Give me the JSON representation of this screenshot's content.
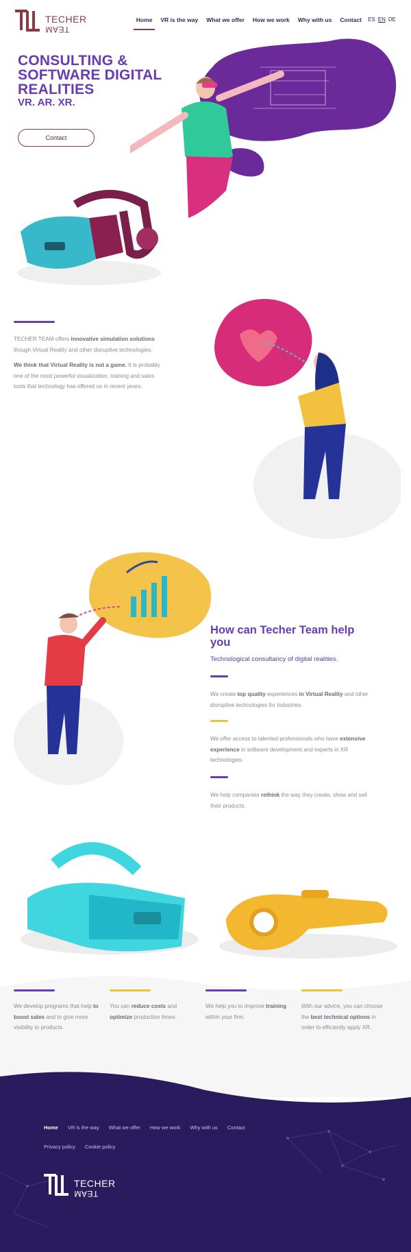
{
  "brand": {
    "name_top": "TECHER",
    "name_bottom": "TEAM"
  },
  "nav": {
    "items": [
      "Home",
      "VR is the way",
      "What we offer",
      "How we work",
      "Why with us",
      "Contact"
    ],
    "active": "Home"
  },
  "lang": {
    "items": [
      "ES",
      "EN",
      "DE"
    ],
    "active": "EN"
  },
  "hero": {
    "title": "CONSULTING & SOFTWARE DIGITAL REALITIES",
    "subtitle": "VR. AR. XR.",
    "button": "Contact"
  },
  "intro": {
    "p1_a": "TECHER TEAM offers ",
    "p1_b": "innovative simulation solutions",
    "p1_c": " though Virtual Reality and other disruptive technologies.",
    "p2_a": "We think that Virtual Reality is not a game.",
    "p2_b": " It is probably one of the most powerful visualization, training and sales tools that technology has offered us in recent years."
  },
  "help": {
    "title": "How can Techer Team help you",
    "subtitle": "Technological consultancy of digital realities.",
    "p1_a": "We create ",
    "p1_b": "top quality",
    "p1_c": " experiences ",
    "p1_d": "in Virtual Reality",
    "p1_e": " and other disruptive technologies for industries.",
    "p2_a": "We offer access to talented professionals who have ",
    "p2_b": "extensive experience",
    "p2_c": " in software development and experts in XR technologies.",
    "p3_a": "We help companies ",
    "p3_b": "rethink",
    "p3_c": " the way they create, show and sell their products."
  },
  "benefits": {
    "b1_a": "We develop programs that help ",
    "b1_b": "to boost sales",
    "b1_c": " and to give more visibility to products.",
    "b2_a": "You can ",
    "b2_b": "reduce costs",
    "b2_c": " and ",
    "b2_d": "optimize",
    "b2_e": " production times.",
    "b3_a": "We help you to improve ",
    "b3_b": "training",
    "b3_c": " within your firm.",
    "b4_a": "With our advice, you can choose the ",
    "b4_b": "best technical options",
    "b4_c": " in order to efficiently apply XR."
  },
  "footer": {
    "nav": [
      "Home",
      "VR is the way",
      "What we offer",
      "How we work",
      "Why with us",
      "Contact"
    ],
    "legal": [
      "Privacy policy",
      "Cookie policy"
    ],
    "logo_top": "TECHER",
    "logo_bottom": "TEAM"
  },
  "colors": {
    "purple": "#6a3bb0",
    "maroon": "#8a3a44",
    "yellow": "#e9c23c",
    "navy": "#2a1a5e",
    "cyan": "#3fd6e0"
  }
}
